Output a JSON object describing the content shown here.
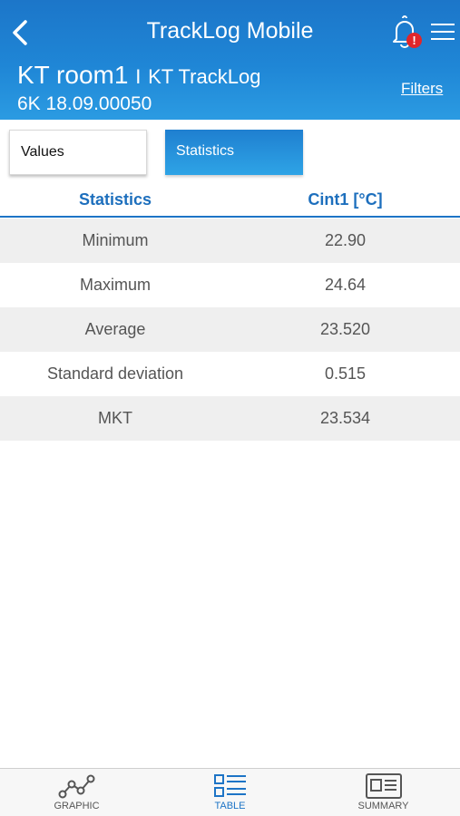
{
  "header": {
    "title": "TrackLog Mobile",
    "alert_badge": "!",
    "device_name": "KT room1",
    "separator": "I",
    "device_app": "KT TrackLog",
    "serial": "6K 18.09.00050",
    "filters_label": "Filters"
  },
  "tabs": [
    {
      "label": "Values",
      "active": false
    },
    {
      "label": "Statistics",
      "active": true
    }
  ],
  "table": {
    "columns": [
      "Statistics",
      "Cint1 [°C]"
    ],
    "rows": [
      {
        "name": "Minimum",
        "value": "22.90"
      },
      {
        "name": "Maximum",
        "value": "24.64"
      },
      {
        "name": "Average",
        "value": "23.520"
      },
      {
        "name": "Standard deviation",
        "value": "0.515"
      },
      {
        "name": "MKT",
        "value": "23.534"
      }
    ]
  },
  "bottom_nav": [
    {
      "label": "GRAPHIC",
      "icon": "graph-line-icon",
      "active": false
    },
    {
      "label": "TABLE",
      "icon": "table-list-icon",
      "active": true
    },
    {
      "label": "SUMMARY",
      "icon": "summary-card-icon",
      "active": false
    }
  ],
  "colors": {
    "header_blue": "#1f86d6",
    "accent_blue": "#1d74c6",
    "alert_red": "#e0262b"
  }
}
